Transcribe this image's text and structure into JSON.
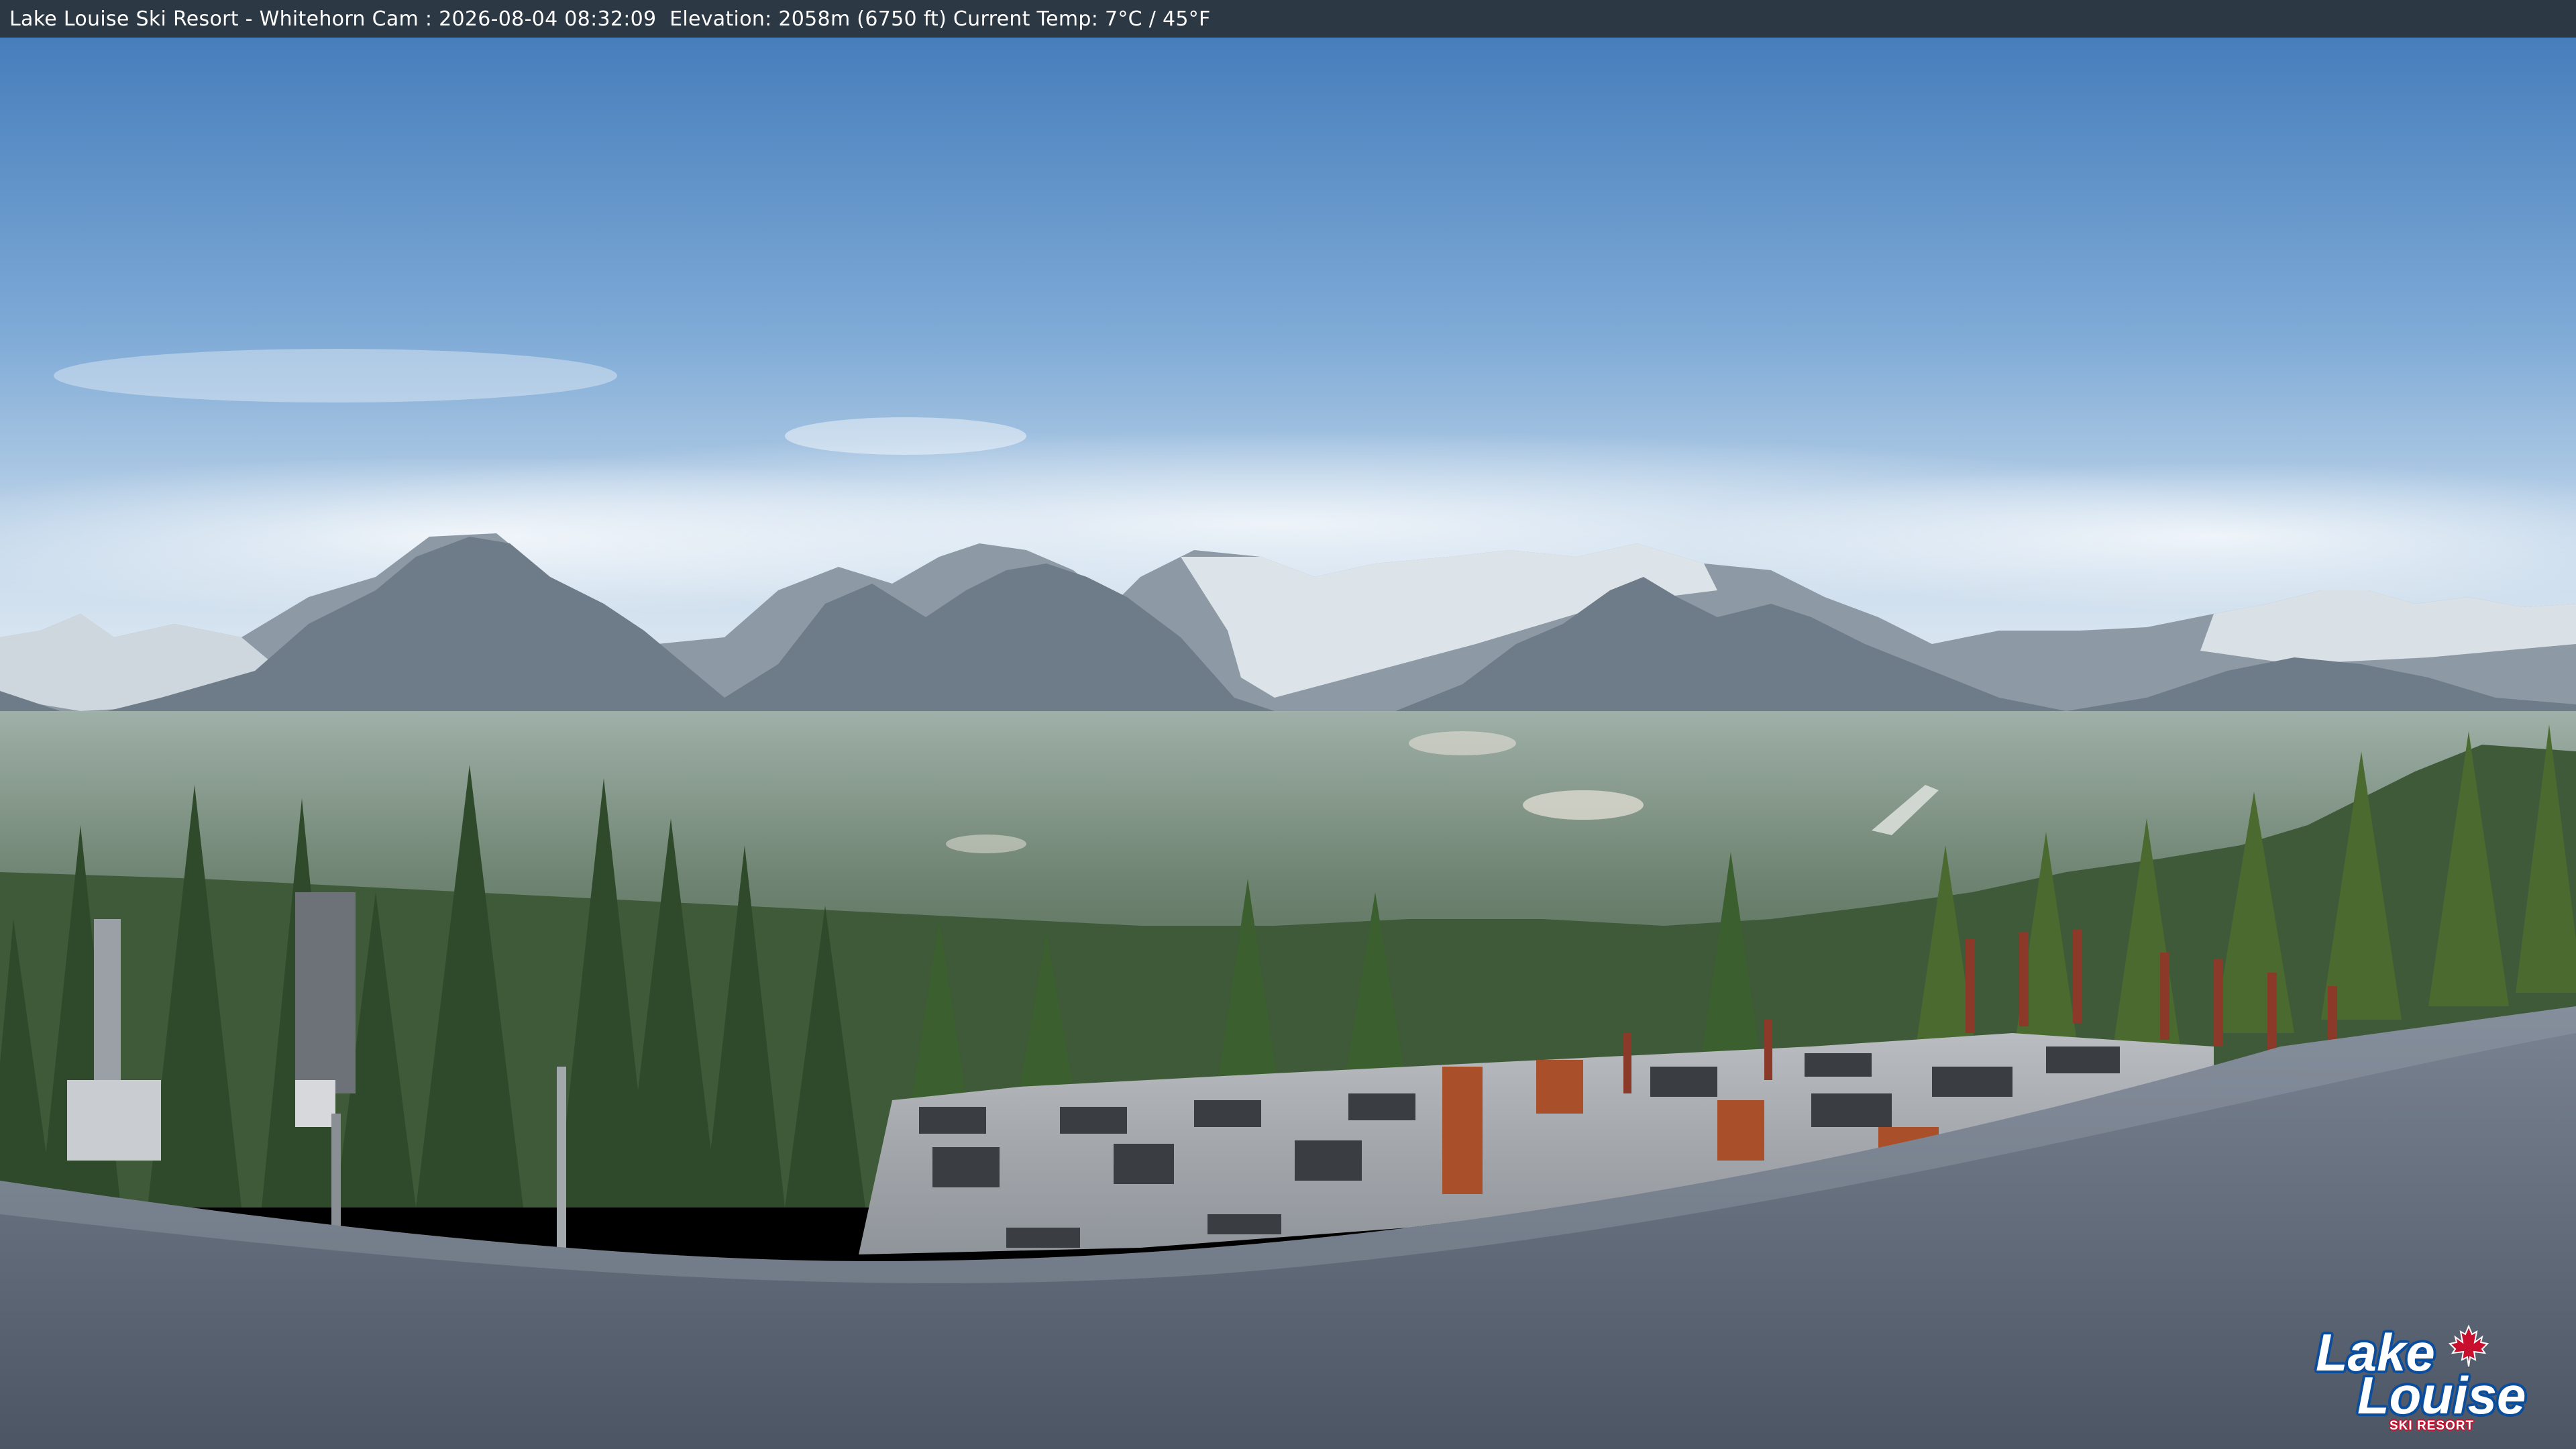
{
  "overlay": {
    "caption": "Lake Louise Ski Resort - Whitehorn Cam : 2026-08-04 08:32:09  Elevation: 2058m (6750 ft) Current Temp: 7°C / 45°F"
  },
  "logo": {
    "line1": "Lake",
    "line2": "Louise",
    "subtitle": "SKI RESORT",
    "icon": "maple-leaf-icon"
  },
  "colors": {
    "status_bar": "#2d3845",
    "sky_top": "#4f86c2",
    "roof": "#5d6675",
    "logo_blue": "#0a4d9c",
    "logo_red": "#c8102e"
  }
}
